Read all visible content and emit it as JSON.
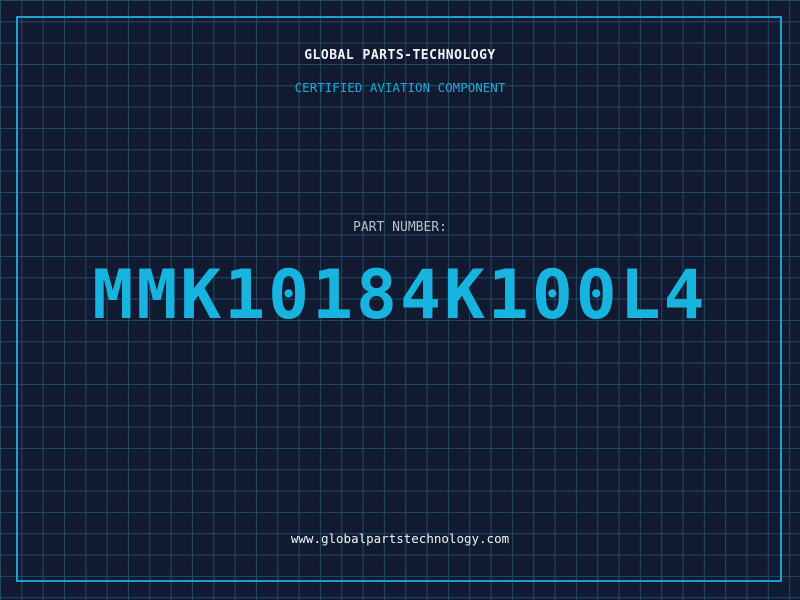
{
  "header": {
    "company": "GLOBAL PARTS-TECHNOLOGY",
    "subtitle": "CERTIFIED AVIATION COMPONENT"
  },
  "part": {
    "label": "PART NUMBER:",
    "number": "MMK10184K100L4"
  },
  "footer": {
    "website": "www.globalpartstechnology.com"
  },
  "colors": {
    "background": "#111a30",
    "grid": "#1f4d66",
    "accent": "#16b4de",
    "text": "#f2f4f7"
  }
}
